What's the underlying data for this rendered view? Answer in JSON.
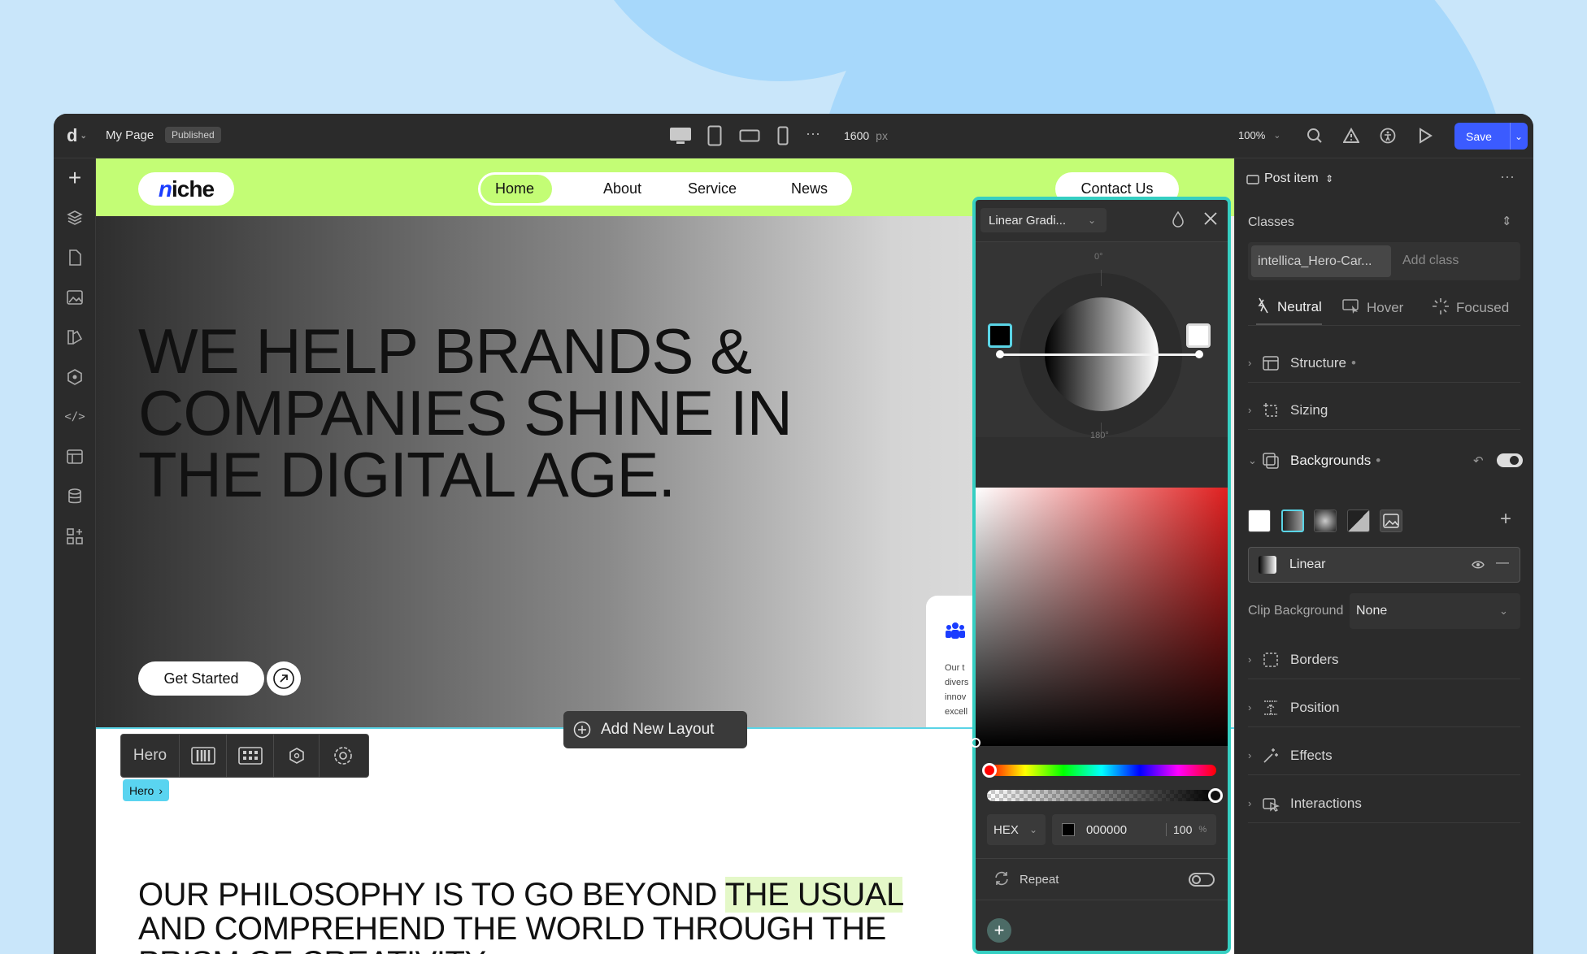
{
  "topbar": {
    "page_name": "My Page",
    "status_badge": "Published",
    "width_value": "1600",
    "width_unit": "px",
    "zoom": "100%",
    "save_label": "Save",
    "accent": "#3b5bff"
  },
  "site": {
    "logo_text": "iche",
    "nav": [
      "Home",
      "About",
      "Service",
      "News"
    ],
    "contact": "Contact Us",
    "hero_title": "WE HELP BRANDS &\nCOMPANIES SHINE IN\nTHE DIGITAL AGE.",
    "get_started": "Get Started",
    "side_card_lines": [
      "Our t",
      "divers",
      "innov",
      "excell"
    ],
    "add_layout": "Add New Layout",
    "hero_bar_label": "Hero",
    "hero_tag": "Hero",
    "philosophy_pre": "OUR PHILOSOPHY IS TO GO BEYOND ",
    "philosophy_highlight": "THE USUAL",
    "philosophy_post": " AND COMPREHEND THE WORLD THROUGH THE PRISM OF CREATIVITY.",
    "accent_green": "#c3fd75"
  },
  "picker": {
    "type_select": "Linear Gradi...",
    "angle_top": "0°",
    "angle_bottom": "180°",
    "format": "HEX",
    "hex_value": "000000",
    "opacity": "100",
    "opacity_unit": "%",
    "repeat_label": "Repeat",
    "border_color": "#35cfc2"
  },
  "panel": {
    "element": "Post item",
    "classes_label": "Classes",
    "class_chip": "intellica_Hero-Car...",
    "add_class_placeholder": "Add class",
    "states": [
      "Neutral",
      "Hover",
      "Focused"
    ],
    "sections": {
      "structure": "Structure",
      "sizing": "Sizing",
      "backgrounds": "Backgrounds",
      "borders": "Borders",
      "position": "Position",
      "effects": "Effects",
      "interactions": "Interactions"
    },
    "background_layer": "Linear",
    "clip_label": "Clip Background",
    "clip_value": "None"
  }
}
